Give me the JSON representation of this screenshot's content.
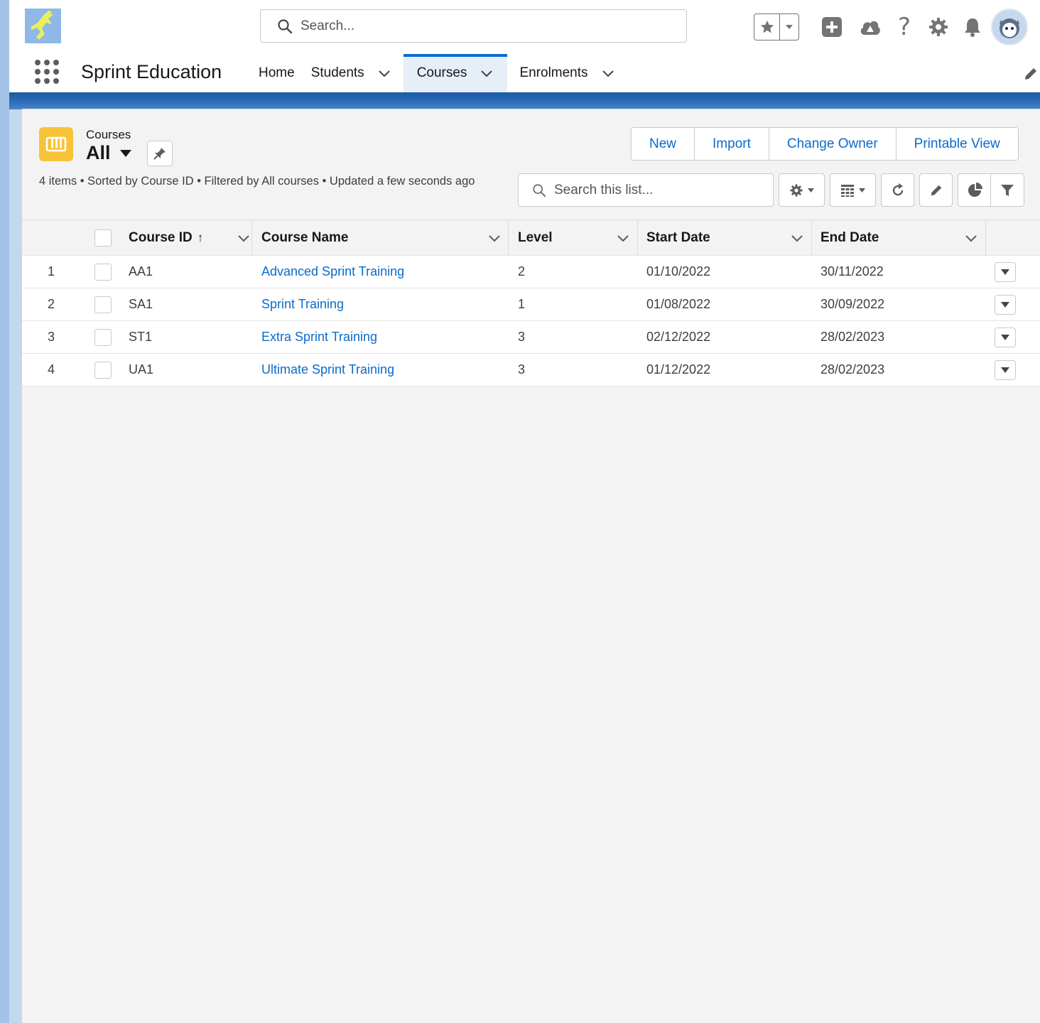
{
  "header": {
    "search_placeholder": "Search...",
    "icons": [
      "favorites-star-icon",
      "chevron-down-icon",
      "add-icon",
      "trailhead-icon",
      "help-icon",
      "setup-gear-icon",
      "notifications-bell-icon",
      "user-avatar"
    ]
  },
  "app": {
    "name": "Sprint Education",
    "tabs": [
      {
        "label": "Home",
        "has_menu": false,
        "active": false
      },
      {
        "label": "Students",
        "has_menu": true,
        "active": false
      },
      {
        "label": "Courses",
        "has_menu": true,
        "active": true
      },
      {
        "label": "Enrolments",
        "has_menu": true,
        "active": false
      }
    ]
  },
  "list_view": {
    "object_label": "Courses",
    "view_name": "All",
    "meta": "4 items • Sorted by Course ID • Filtered by All courses • Updated a few seconds ago",
    "buttons": [
      "New",
      "Import",
      "Change Owner",
      "Printable View"
    ],
    "search_placeholder": "Search this list..."
  },
  "table": {
    "columns": [
      "Course ID",
      "Course Name",
      "Level",
      "Start Date",
      "End Date"
    ],
    "sort_indicator": "↑",
    "rows": [
      {
        "num": "1",
        "id": "AA1",
        "name": "Advanced Sprint Training",
        "level": "2",
        "start": "01/10/2022",
        "end": "30/11/2022"
      },
      {
        "num": "2",
        "id": "SA1",
        "name": "Sprint Training",
        "level": "1",
        "start": "01/08/2022",
        "end": "30/09/2022"
      },
      {
        "num": "3",
        "id": "ST1",
        "name": "Extra Sprint Training",
        "level": "3",
        "start": "02/12/2022",
        "end": "28/02/2023"
      },
      {
        "num": "4",
        "id": "UA1",
        "name": "Ultimate Sprint Training",
        "level": "3",
        "start": "01/12/2022",
        "end": "28/02/2023"
      }
    ]
  },
  "colors": {
    "brand_blue": "#0b6bcb",
    "object_icon_yellow": "#f7c339",
    "band_blue": "#1a5aa5"
  }
}
